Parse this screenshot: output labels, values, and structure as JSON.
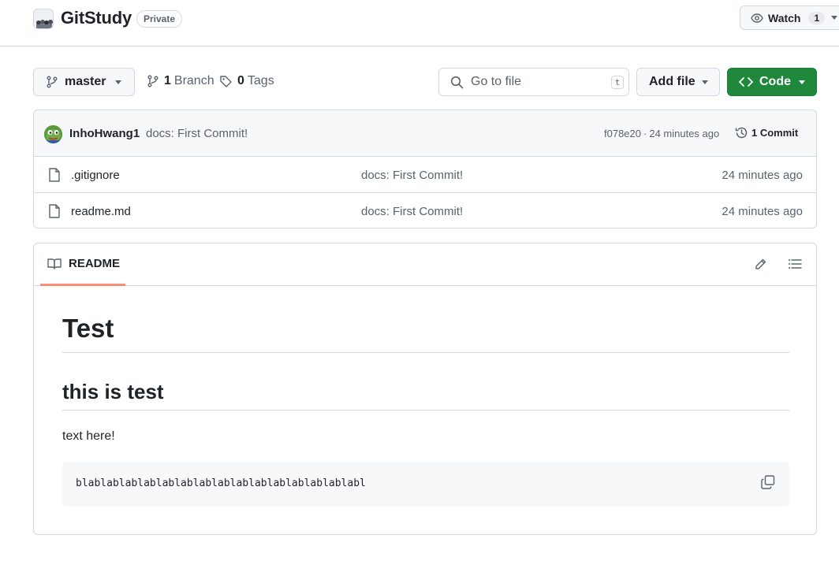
{
  "repo": {
    "name": "GitStudy",
    "visibility": "Private",
    "avatar_icon": "repo-owner-avatar"
  },
  "watch": {
    "label": "Watch",
    "count": "1",
    "icon": "eye-icon"
  },
  "toolbar": {
    "branch_name": "master",
    "branches_count": "1",
    "branches_word": "Branch",
    "tags_count": "0",
    "tags_word": "Tags",
    "search_placeholder": "Go to file",
    "search_hotkey": "t",
    "add_file_label": "Add file",
    "code_label": "Code"
  },
  "latest_commit": {
    "author": "InhoHwang1",
    "message": "docs: First Commit!",
    "sha": "f078e20",
    "separator": "·",
    "time": "24 minutes ago",
    "commits_label": "1 Commit"
  },
  "files": [
    {
      "name": ".gitignore",
      "message": "docs: First Commit!",
      "time": "24 minutes ago",
      "icon": "file-icon"
    },
    {
      "name": "readme.md",
      "message": "docs: First Commit!",
      "time": "24 minutes ago",
      "icon": "file-icon"
    }
  ],
  "readme": {
    "tab_label": "README",
    "h1": "Test",
    "h2": "this is test",
    "paragraph": "text here!",
    "code": "blablablablablablablablablablablablablablablabl"
  },
  "colors": {
    "primary_green": "#1f883d",
    "tab_underline": "#fd8c73",
    "border": "#d1d9e0",
    "muted_text": "#59636e"
  }
}
